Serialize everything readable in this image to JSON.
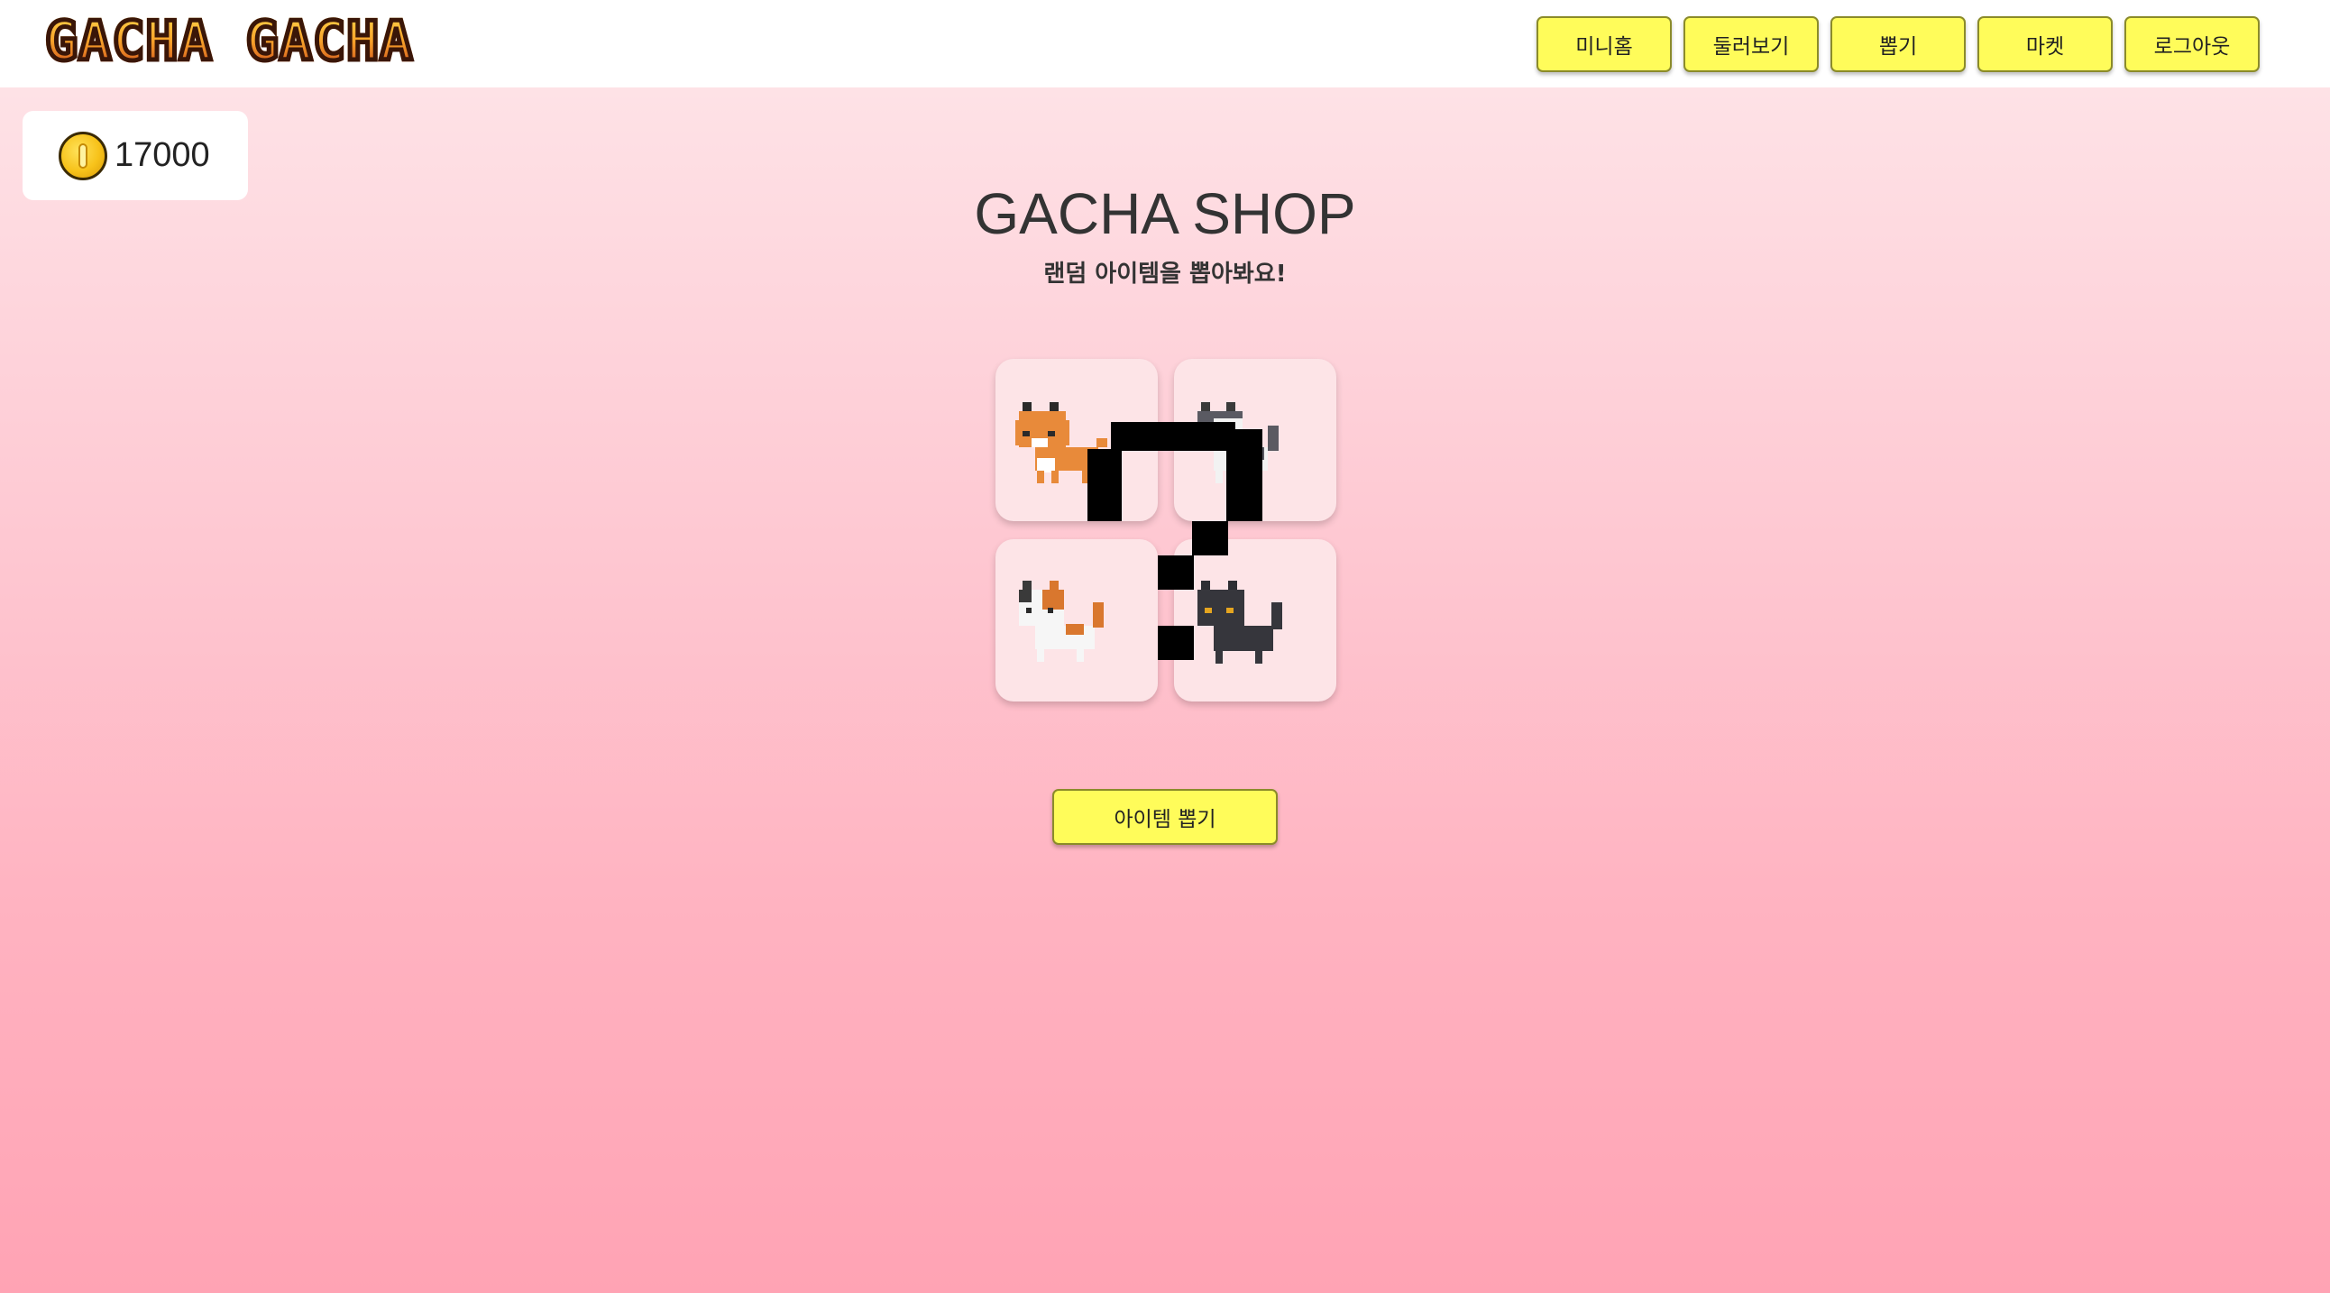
{
  "app": {
    "logo_text": "GACHA GACHA"
  },
  "nav": {
    "items": [
      {
        "label": "미니홈"
      },
      {
        "label": "둘러보기"
      },
      {
        "label": "뽑기"
      },
      {
        "label": "마켓"
      },
      {
        "label": "로그아웃"
      }
    ]
  },
  "wallet": {
    "icon": "coin-icon",
    "balance": "17000"
  },
  "shop": {
    "title": "GACHA SHOP",
    "subtitle": "랜덤 아이템을 뽑아봐요!",
    "items": [
      {
        "icon": "orange-cat-icon"
      },
      {
        "icon": "gray-white-cat-icon"
      },
      {
        "icon": "calico-cat-icon"
      },
      {
        "icon": "black-cat-icon"
      }
    ],
    "draw_button": "아이템 뽑기"
  },
  "colors": {
    "button_yellow": "#fffc5a",
    "background_top": "#fee7ea",
    "background_bottom": "#ffa3b4",
    "tile_bg": "#fde4e7"
  }
}
